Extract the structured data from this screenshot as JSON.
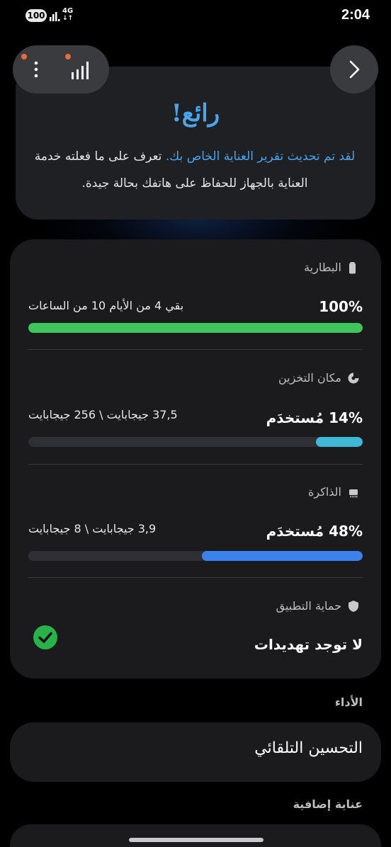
{
  "status_bar": {
    "battery": "100",
    "network": "4G",
    "time": "2:04"
  },
  "toolbar": {
    "more_icon": "more-vertical-icon",
    "stats_icon": "stats-icon",
    "next_icon": "chevron-right-icon",
    "badge_color": "#e86d3a"
  },
  "hero": {
    "title": "رائع!",
    "text_link": "لقد تم تحديث تقرير العناية الخاص بك.",
    "text_rest": " تعرف على ما فعلته خدمة العناية بالجهاز للحفاظ على هاتفك بحالة جيدة."
  },
  "battery": {
    "title": "البطارية",
    "percent_text": "100%",
    "detail": "بقي 4 من الأيام 10 من الساعات",
    "level": 1.0,
    "color": "#3ec65b"
  },
  "storage": {
    "title": "مكان التخزين",
    "percent_text": "14% مُستخدَم",
    "detail": "37,5 جيجابايت \\ 256 جيجابايت",
    "level": 0.14,
    "color": "#3fb8d8"
  },
  "memory": {
    "title": "الذاكرة",
    "percent_text": "48% مُستخدَم",
    "detail": "3,9 جيجابايت \\ 8 جيجابايت",
    "level": 0.48,
    "color": "#3b82f0"
  },
  "app_protection": {
    "title": "حماية التطبيق",
    "status": "لا توجد تهديدات",
    "status_color": "#2ab24a"
  },
  "performance": {
    "label": "الأداء",
    "auto_optimize": "التحسين التلقائي"
  },
  "extra_care": {
    "label": "عناية إضافية"
  }
}
